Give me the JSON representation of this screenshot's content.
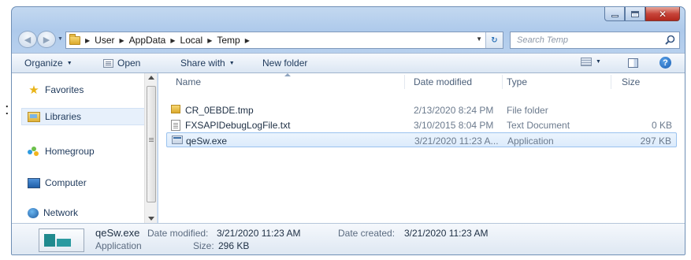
{
  "address_bar": {
    "crumbs": [
      "User",
      "AppData",
      "Local",
      "Temp"
    ]
  },
  "search": {
    "placeholder": "Search Temp"
  },
  "toolbar": {
    "organize": "Organize",
    "open": "Open",
    "share_with": "Share with",
    "new_folder": "New folder"
  },
  "nav_pane": {
    "items": [
      {
        "label": "Favorites",
        "icon": "star-icon"
      },
      {
        "label": "Libraries",
        "icon": "libraries-icon"
      },
      {
        "label": "Homegroup",
        "icon": "homegroup-icon"
      },
      {
        "label": "Computer",
        "icon": "computer-icon"
      },
      {
        "label": "Network",
        "icon": "network-icon"
      }
    ]
  },
  "file_list": {
    "columns": [
      "Name",
      "Date modified",
      "Type",
      "Size"
    ],
    "rows": [
      {
        "name": "CR_0EBDE.tmp",
        "date": "2/13/2020 8:24 PM",
        "type": "File folder",
        "size": "",
        "icon": "folder-icon"
      },
      {
        "name": "FXSAPIDebugLogFile.txt",
        "date": "3/10/2015 8:04 PM",
        "type": "Text Document",
        "size": "0 KB",
        "icon": "text-file-icon"
      },
      {
        "name": "qeSw.exe",
        "date": "3/21/2020 11:23 A...",
        "type": "Application",
        "size": "297 KB",
        "icon": "application-icon",
        "selected": true
      }
    ]
  },
  "details": {
    "name": "qeSw.exe",
    "kind": "Application",
    "date_modified_label": "Date modified:",
    "date_modified": "3/21/2020 11:23 AM",
    "date_created_label": "Date created:",
    "date_created": "3/21/2020 11:23 AM",
    "size_label": "Size:",
    "size": "296 KB"
  },
  "colors": {
    "selection": "#dcebfc",
    "close_button": "#c7443a",
    "frame": "#aecaeb"
  }
}
